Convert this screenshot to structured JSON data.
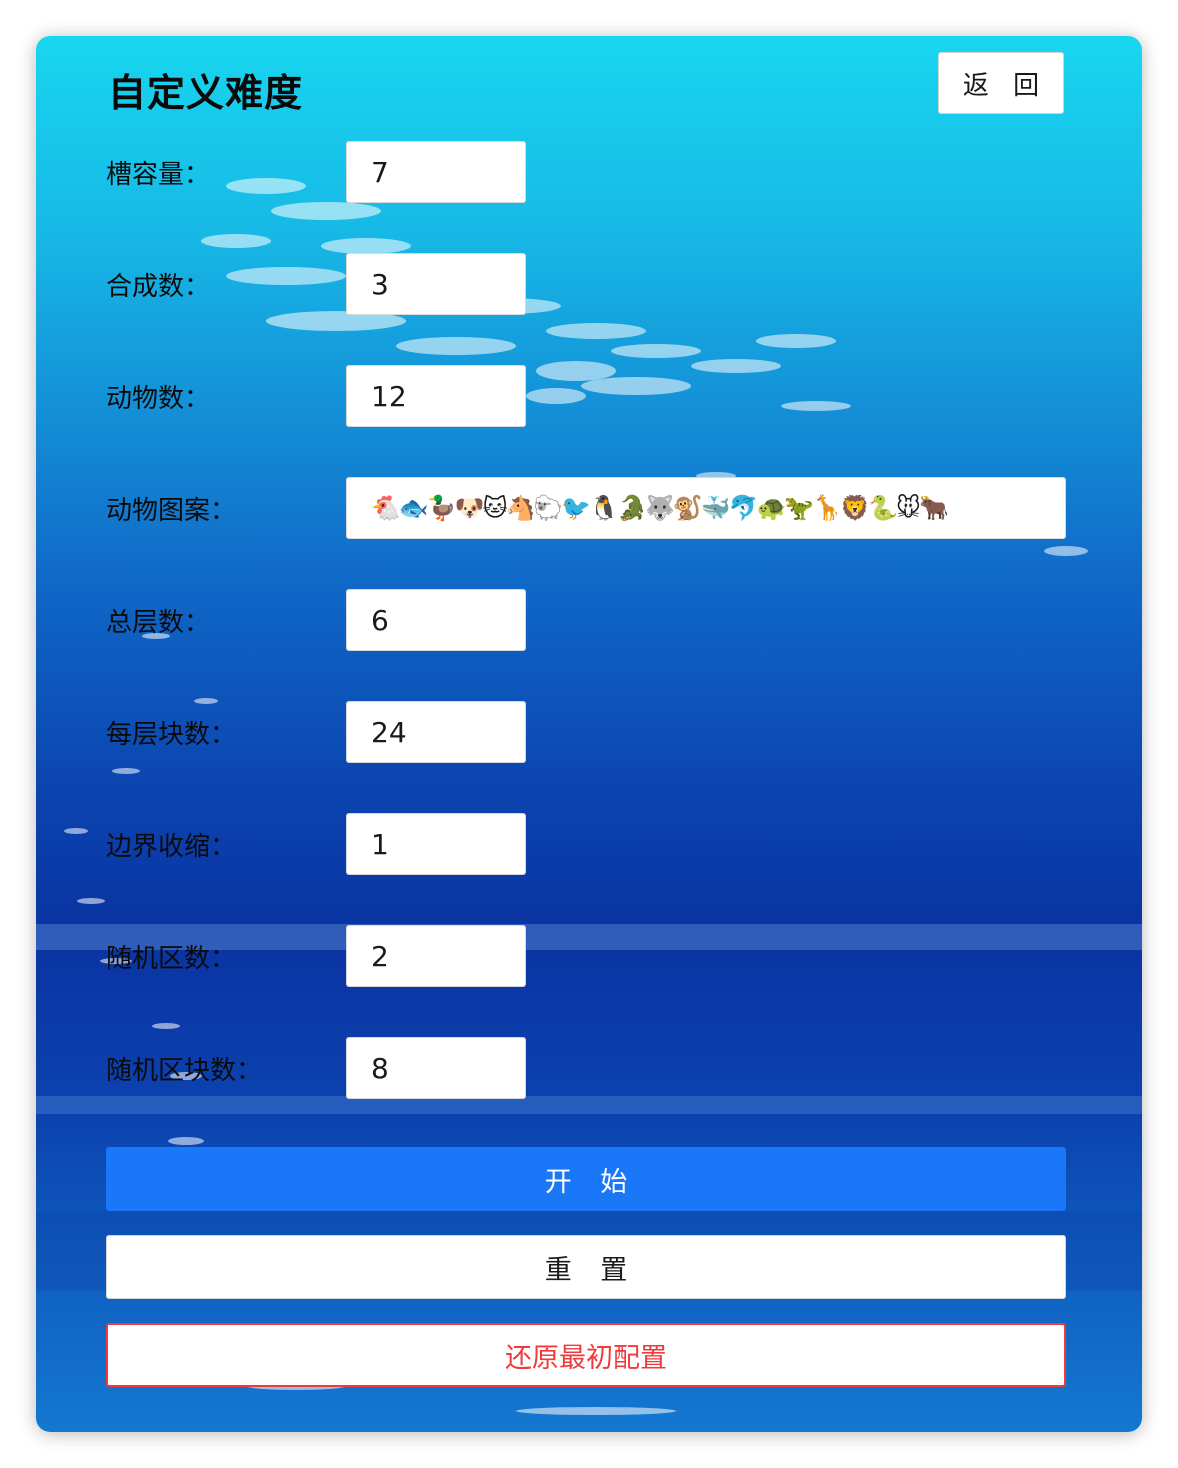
{
  "header": {
    "title": "自定义难度",
    "back_label": "返 回"
  },
  "fields": [
    {
      "label": "槽容量：",
      "value": "7"
    },
    {
      "label": "合成数：",
      "value": "3"
    },
    {
      "label": "动物数：",
      "value": "12"
    },
    {
      "label": "动物图案：",
      "value": "🐔🐟🦆🐶🐱🐴🐑🐦🐧🐊🐺🐒🐳🐬🐢🦖🦒🦁🐍🐭🐂"
    },
    {
      "label": "总层数：",
      "value": "6"
    },
    {
      "label": "每层块数：",
      "value": "24"
    },
    {
      "label": "边界收缩：",
      "value": "1"
    },
    {
      "label": "随机区数：",
      "value": "2"
    },
    {
      "label": "随机区块数：",
      "value": "8"
    }
  ],
  "actions": {
    "start_label": "开 始",
    "reset_label": "重 置",
    "restore_label": "还原最初配置"
  },
  "colors": {
    "primary": "#1a77f7",
    "danger": "#ef3b3b",
    "background_top": "#18d6ef",
    "background_mid": "#0a34a2"
  }
}
